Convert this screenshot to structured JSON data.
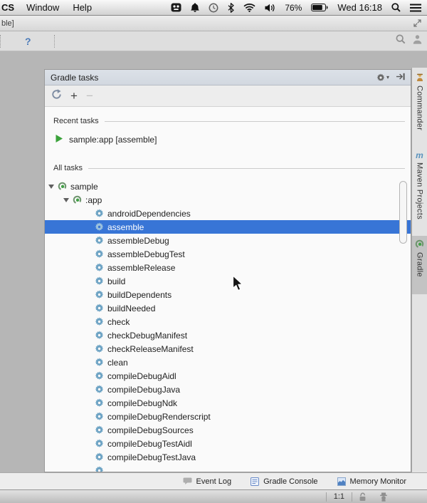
{
  "menu_bar": {
    "app_menu_partial": "CS",
    "items": [
      "Window",
      "Help"
    ],
    "battery_percent": "76%",
    "clock": "Wed 16:18",
    "status_icons": [
      "app-tray-icon",
      "notifications-bell-icon",
      "time-machine-icon",
      "bluetooth-icon",
      "wifi-icon",
      "volume-icon",
      "battery-icon",
      "spotlight-search-icon",
      "notification-center-icon"
    ]
  },
  "window": {
    "title_partial": "ble]",
    "toolbar_help": "?",
    "toolbar_icons": [
      "search-icon",
      "avatar-icon"
    ]
  },
  "gradle_panel": {
    "title": "Gradle tasks",
    "header_icons": [
      "gear-icon",
      "hide-panel-icon"
    ],
    "toolbar_icons": [
      "refresh-icon",
      "add-icon",
      "remove-icon"
    ],
    "add_label": "+",
    "remove_label": "−",
    "recent_section_label": "Recent tasks",
    "all_section_label": "All tasks",
    "recent_tasks": [
      "sample:app [assemble]"
    ],
    "tree": [
      {
        "label": "sample",
        "depth": 0,
        "type": "project",
        "expanded": true
      },
      {
        "label": ":app",
        "depth": 1,
        "type": "project",
        "expanded": true
      },
      {
        "label": "androidDependencies",
        "depth": 2,
        "type": "task"
      },
      {
        "label": "assemble",
        "depth": 2,
        "type": "task",
        "selected": true
      },
      {
        "label": "assembleDebug",
        "depth": 2,
        "type": "task"
      },
      {
        "label": "assembleDebugTest",
        "depth": 2,
        "type": "task"
      },
      {
        "label": "assembleRelease",
        "depth": 2,
        "type": "task"
      },
      {
        "label": "build",
        "depth": 2,
        "type": "task"
      },
      {
        "label": "buildDependents",
        "depth": 2,
        "type": "task"
      },
      {
        "label": "buildNeeded",
        "depth": 2,
        "type": "task"
      },
      {
        "label": "check",
        "depth": 2,
        "type": "task"
      },
      {
        "label": "checkDebugManifest",
        "depth": 2,
        "type": "task"
      },
      {
        "label": "checkReleaseManifest",
        "depth": 2,
        "type": "task"
      },
      {
        "label": "clean",
        "depth": 2,
        "type": "task"
      },
      {
        "label": "compileDebugAidl",
        "depth": 2,
        "type": "task"
      },
      {
        "label": "compileDebugJava",
        "depth": 2,
        "type": "task"
      },
      {
        "label": "compileDebugNdk",
        "depth": 2,
        "type": "task"
      },
      {
        "label": "compileDebugRenderscript",
        "depth": 2,
        "type": "task"
      },
      {
        "label": "compileDebugSources",
        "depth": 2,
        "type": "task"
      },
      {
        "label": "compileDebugTestAidl",
        "depth": 2,
        "type": "task"
      },
      {
        "label": "compileDebugTestJava",
        "depth": 2,
        "type": "task"
      }
    ]
  },
  "side_tabs": [
    {
      "label": "Commander",
      "icon": "commander-icon",
      "active": false
    },
    {
      "label": "Maven Projects",
      "icon": "maven-icon",
      "active": false
    },
    {
      "label": "Gradle",
      "icon": "gradle-icon",
      "active": true
    }
  ],
  "bottom_bar": [
    {
      "label": "Event Log",
      "icon": "event-log-icon"
    },
    {
      "label": "Gradle Console",
      "icon": "gradle-console-icon"
    },
    {
      "label": "Memory Monitor",
      "icon": "memory-monitor-icon"
    }
  ],
  "status_bar": {
    "caret_position": "1:1",
    "icons": [
      "lock-icon",
      "hector-inspector-icon"
    ]
  },
  "colors": {
    "selection_blue": "#3875d6",
    "task_gear_blue": "#6da3c4",
    "run_green": "#3aa23a",
    "panel_header": "#d8dde4"
  }
}
